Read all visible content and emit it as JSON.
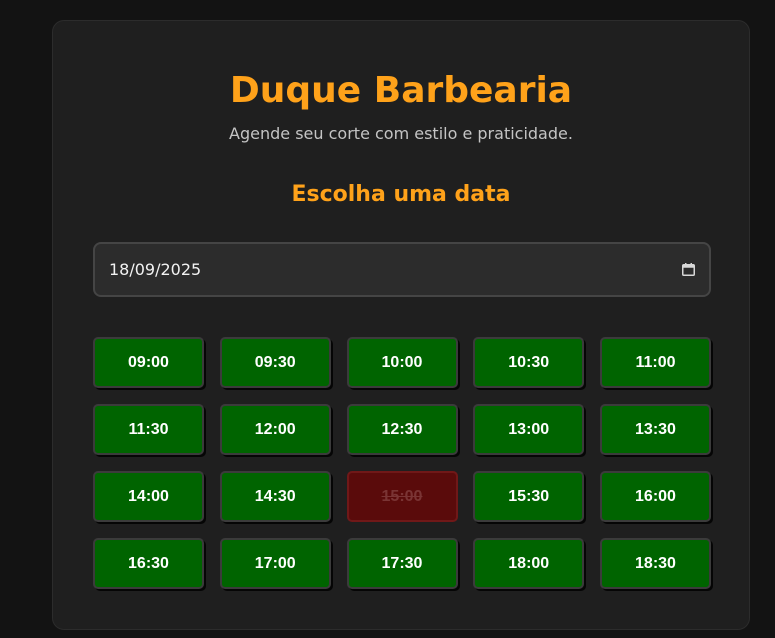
{
  "header": {
    "title": "Duque Barbearia",
    "subtitle": "Agende seu corte com estilo e praticidade."
  },
  "date_section": {
    "title": "Escolha uma data",
    "date_value": "18/09/2025",
    "calendar_icon": "calendar-icon"
  },
  "colors": {
    "accent": "#ffa21a",
    "available": "#006400",
    "booked": "#5a0b0b"
  },
  "slots": [
    {
      "time": "09:00",
      "status": "available"
    },
    {
      "time": "09:30",
      "status": "available"
    },
    {
      "time": "10:00",
      "status": "available"
    },
    {
      "time": "10:30",
      "status": "available"
    },
    {
      "time": "11:00",
      "status": "available"
    },
    {
      "time": "11:30",
      "status": "available"
    },
    {
      "time": "12:00",
      "status": "available"
    },
    {
      "time": "12:30",
      "status": "available"
    },
    {
      "time": "13:00",
      "status": "available"
    },
    {
      "time": "13:30",
      "status": "available"
    },
    {
      "time": "14:00",
      "status": "available"
    },
    {
      "time": "14:30",
      "status": "available"
    },
    {
      "time": "15:00",
      "status": "booked"
    },
    {
      "time": "15:30",
      "status": "available"
    },
    {
      "time": "16:00",
      "status": "available"
    },
    {
      "time": "16:30",
      "status": "available"
    },
    {
      "time": "17:00",
      "status": "available"
    },
    {
      "time": "17:30",
      "status": "available"
    },
    {
      "time": "18:00",
      "status": "available"
    },
    {
      "time": "18:30",
      "status": "available"
    }
  ]
}
